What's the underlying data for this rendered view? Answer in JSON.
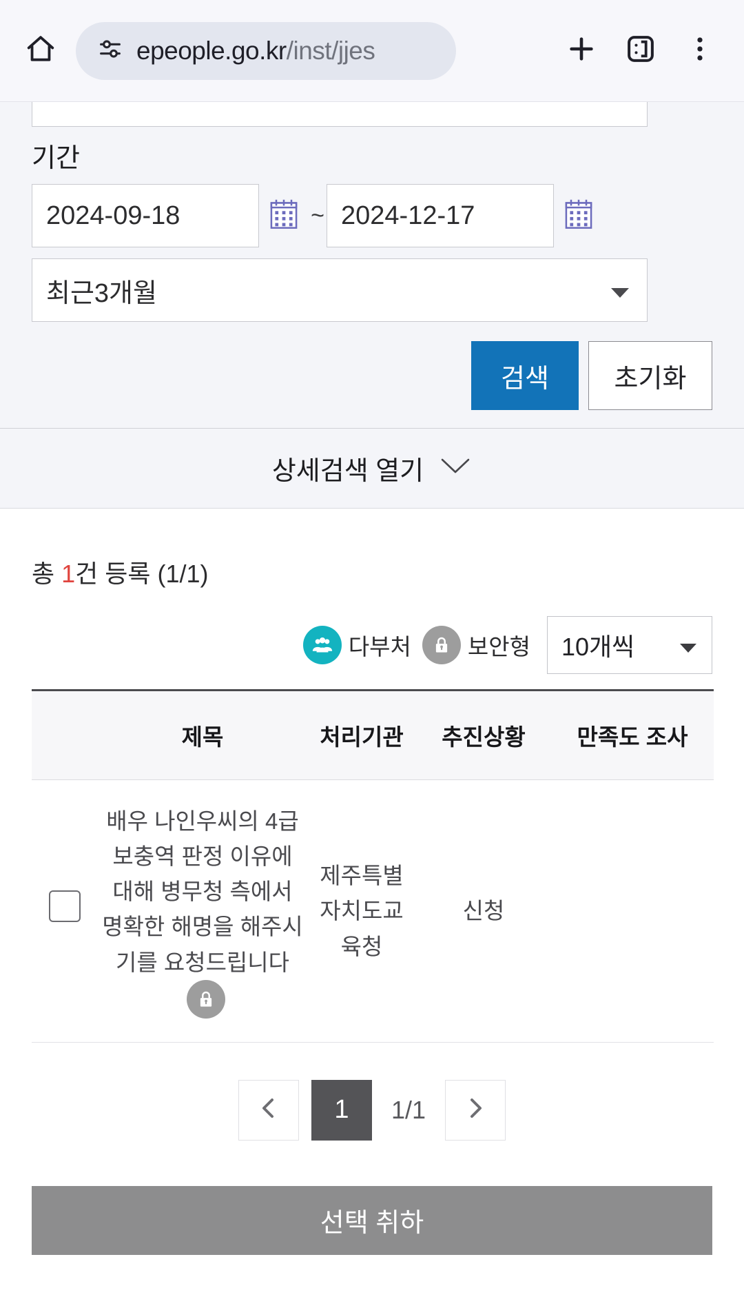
{
  "browser": {
    "home_icon": "home-icon",
    "site_info_icon": "site-settings-icon",
    "url_main": "epeople.go.kr",
    "url_path": "/inst/jjes",
    "new_tab_icon": "plus-icon",
    "tab_count_icon": "tab-switcher-icon",
    "menu_icon": "more-vertical-icon"
  },
  "search": {
    "keyword_value": "",
    "keyword_placeholder": "",
    "period_label": "기간",
    "date_from": "2024-09-18",
    "date_to": "2024-12-17",
    "tilde": "~",
    "calendar_icon": "calendar-icon",
    "range_preset": "최근3개월",
    "search_button": "검색",
    "reset_button": "초기화",
    "detail_toggle": "상세검색 열기"
  },
  "results": {
    "total_prefix": "총 ",
    "total_number": "1",
    "total_suffix": "건 등록 (1/1)",
    "legend": [
      {
        "icon": "multi-agency-icon",
        "label": "다부처",
        "color": "#13b3c0"
      },
      {
        "icon": "lock-icon",
        "label": "보안형",
        "color": "#9d9d9d"
      }
    ],
    "per_page": "10개씩",
    "headers": {
      "checkbox": "",
      "title": "제목",
      "org": "처리기관",
      "status": "추진상황",
      "satisfaction": "만족도 조사"
    },
    "rows": [
      {
        "checked": false,
        "title": "배우 나인우씨의 4급 보충역 판정 이유에 대해 병무청 측에서 명확한 해명을 해주시기를 요청드립니다",
        "secure": true,
        "org": "제주특별자치도교육청",
        "status": "신청",
        "satisfaction": ""
      }
    ]
  },
  "pagination": {
    "prev_icon": "chevron-left-icon",
    "current_page": "1",
    "page_label": "1/1",
    "next_icon": "chevron-right-icon"
  },
  "footer": {
    "cancel_button": "선택 취하"
  }
}
